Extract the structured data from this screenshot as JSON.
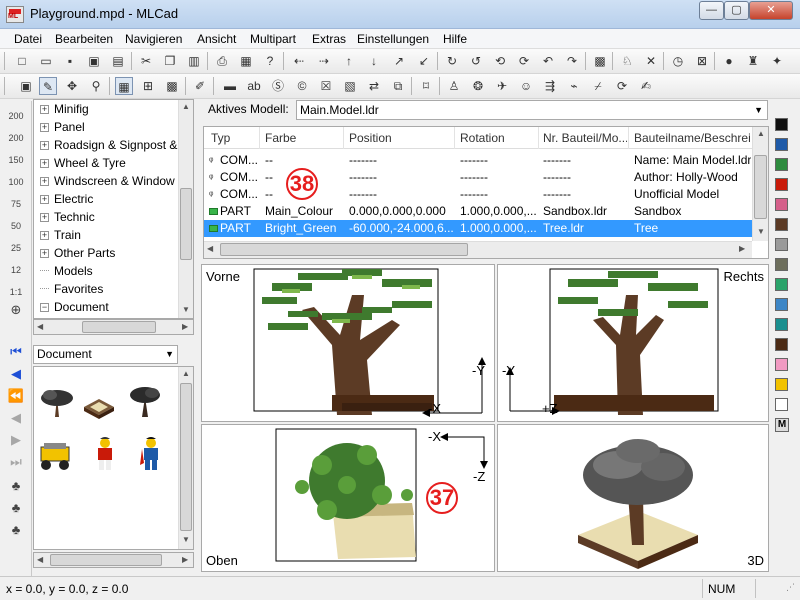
{
  "window": {
    "title": "Playground.mpd - MLCad",
    "minimize": "—",
    "maximize": "▢",
    "close": "✕"
  },
  "menu": [
    "Datei",
    "Bearbeiten",
    "Navigieren",
    "Ansicht",
    "Multipart",
    "Extras",
    "Einstellungen",
    "Hilfe"
  ],
  "toolbar1_icons": [
    "new-icon",
    "open-icon",
    "save-icon",
    "save-as-icon",
    "cut-icon",
    "copy-icon",
    "paste-icon",
    "delete-icon",
    "print-icon",
    "properties-icon",
    "help-icon",
    "move-left-icon",
    "move-right-icon",
    "move-up-icon",
    "move-down-icon",
    "move-back-icon",
    "move-front-icon",
    "rotate-x-icon",
    "rotate-y-icon",
    "rotate-z-icon",
    "rotate-x2-icon",
    "rotate-y2-icon",
    "calculator-icon",
    "bell-icon",
    "cross-icon",
    "clock-icon",
    "x-mark-icon",
    "bulb-icon",
    "hat-icon",
    "fish-icon"
  ],
  "toolbar2_icons": [
    "view-select-icon",
    "edit-icon",
    "move-icon",
    "zoom-icon",
    "single-view-icon",
    "quad-view-icon",
    "grid-icon",
    "pencil-icon",
    "step-icon",
    "text-icon",
    "rotation-step-icon",
    "clear-icon",
    "ghost-icon",
    "buffer-icon",
    "buffer-exchange-icon",
    "group-icon",
    "skeleton-icon",
    "minifig-icon",
    "flex-icon",
    "face-icon",
    "arrow-icon",
    "hose-icon",
    "edit-line-icon",
    "rotate-icon",
    "write-icon"
  ],
  "leftstrip": {
    "zoom_labels": [
      "200",
      "200",
      "150",
      "100",
      "75",
      "50",
      "25",
      "12",
      "1:1"
    ],
    "nav": [
      "first-step-icon",
      "previous-step-icon",
      "pause-icon",
      "step-back-icon",
      "play-icon",
      "last-step-icon",
      "model-icon",
      "model-step-icon",
      "model-all-icon"
    ]
  },
  "tree": {
    "items": [
      {
        "label": "Minifig",
        "exp": "+"
      },
      {
        "label": "Panel",
        "exp": "+"
      },
      {
        "label": "Roadsign & Signpost &",
        "exp": "+"
      },
      {
        "label": "Wheel & Tyre",
        "exp": "+"
      },
      {
        "label": "Windscreen & Window",
        "exp": "+"
      },
      {
        "label": "Electric",
        "exp": "+"
      },
      {
        "label": "Technic",
        "exp": "+"
      },
      {
        "label": "Train",
        "exp": "+"
      },
      {
        "label": "Other Parts",
        "exp": "+"
      },
      {
        "label": "Models",
        "exp": ""
      },
      {
        "label": "Favorites",
        "exp": ""
      },
      {
        "label": "Document",
        "exp": "−"
      }
    ]
  },
  "doc_dropdown": {
    "value": "Document"
  },
  "model": {
    "label": "Aktives Modell:",
    "value": "Main.Model.ldr"
  },
  "list": {
    "columns": [
      "Typ",
      "Farbe",
      "Position",
      "Rotation",
      "Nr. Bauteil/Mo...",
      "Bauteilname/Beschreibu"
    ],
    "rows": [
      {
        "typ": "COM...",
        "farbe": "--",
        "pos": "-------",
        "rot": "-------",
        "nr": "-------",
        "name": "Name: Main Model.ldr",
        "icon": "cm"
      },
      {
        "typ": "COM...",
        "farbe": "--",
        "pos": "-------",
        "rot": "-------",
        "nr": "-------",
        "name": "Author: Holly-Wood",
        "icon": "cm"
      },
      {
        "typ": "COM...",
        "farbe": "--",
        "pos": "-------",
        "rot": "-------",
        "nr": "-------",
        "name": "Unofficial Model",
        "icon": "cm"
      },
      {
        "typ": "PART",
        "farbe": "Main_Colour",
        "pos": "0.000,0.000,0.000",
        "rot": "1.000,0.000,...",
        "nr": "Sandbox.ldr",
        "name": "Sandbox",
        "icon": "green"
      },
      {
        "typ": "PART",
        "farbe": "Bright_Green",
        "pos": "-60.000,-24.000,6...",
        "rot": "1.000,0.000,...",
        "nr": "Tree.ldr",
        "name": "Tree",
        "icon": "green",
        "selected": true
      }
    ]
  },
  "badges": {
    "b38": "38",
    "b37": "37"
  },
  "views": {
    "front": {
      "label": "Vorne",
      "ax1": "-Y",
      "ax2": "-X"
    },
    "right": {
      "label": "Rechts",
      "ax1": "-Y",
      "ax2": "+Z"
    },
    "top": {
      "label": "Oben",
      "ax1": "-X",
      "ax2": "-Z"
    },
    "persp": {
      "label": "3D"
    }
  },
  "palette": {
    "colors": [
      "#111111",
      "#1e5aa8",
      "#2e8b3e",
      "#c91a09",
      "#d55f8a",
      "#5c3b25",
      "#9a9a9a",
      "#6d6e5c",
      "#2aa36a",
      "#3d86c6",
      "#1a8f8f",
      "#4b2a14",
      "#f19ac2",
      "#f2c200",
      "#ffffff"
    ],
    "more": "M"
  },
  "status": {
    "coords": "x = 0.0, y = 0.0, z = 0.0",
    "num": "NUM"
  }
}
